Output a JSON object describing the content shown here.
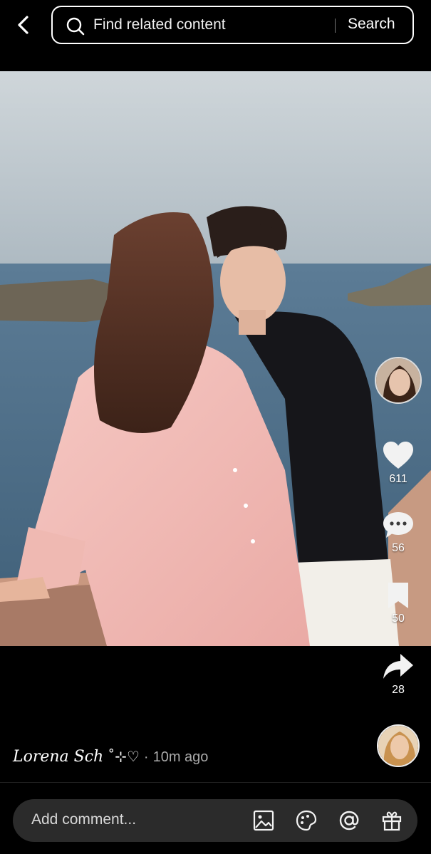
{
  "header": {
    "search_placeholder": "Find related content",
    "search_button": "Search"
  },
  "post": {
    "author_name": "Lorena Sch",
    "author_decoration": "˚⊹♡",
    "separator": "·",
    "time_ago": "10m ago"
  },
  "actions": {
    "likes": "611",
    "comments": "56",
    "saves": "50",
    "shares": "28"
  },
  "comment_bar": {
    "placeholder": "Add comment..."
  },
  "icons": [
    "back-icon",
    "search-icon",
    "heart-icon",
    "comment-icon",
    "bookmark-icon",
    "share-icon",
    "image-icon",
    "emoji-icon",
    "mention-icon",
    "gift-icon"
  ],
  "colors": {
    "background": "#000000",
    "comment_bar": "#2b2b2b",
    "text_secondary": "#aaaaaa"
  }
}
